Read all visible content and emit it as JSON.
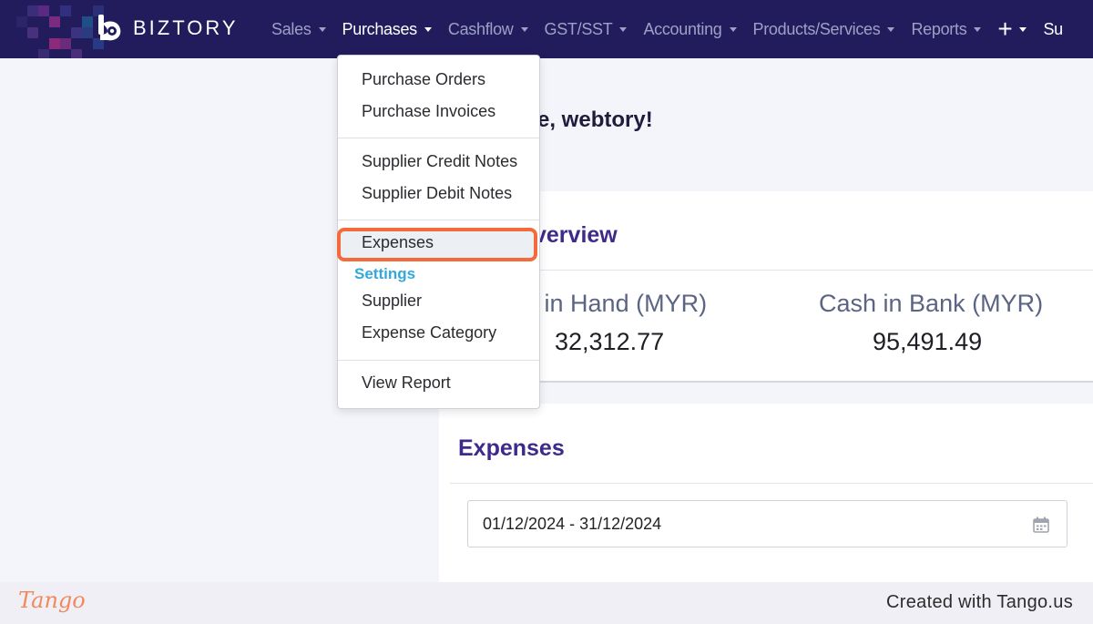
{
  "brand": {
    "name": "BIZTORY",
    "nav_bg": "#221c5c",
    "accent": "#3e2a8c"
  },
  "nav": {
    "items": [
      {
        "label": "Sales",
        "active": false
      },
      {
        "label": "Purchases",
        "active": true
      },
      {
        "label": "Cashflow",
        "active": false
      },
      {
        "label": "GST/SST",
        "active": false
      },
      {
        "label": "Accounting",
        "active": false
      },
      {
        "label": "Products/Services",
        "active": false
      },
      {
        "label": "Reports",
        "active": false
      }
    ],
    "plus_label": "+",
    "overflow_label": "Su"
  },
  "dropdown": {
    "items": [
      "Purchase Orders",
      "Purchase Invoices",
      "Supplier Credit Notes",
      "Supplier Debit Notes",
      "Expenses",
      "Supplier",
      "Expense Category",
      "View Report"
    ],
    "settings_header": "Settings",
    "highlighted_item": "Expenses",
    "highlight_color": "#f36b3d"
  },
  "main": {
    "welcome": "e, webtory!",
    "overview_title": "verview",
    "cash_in_hand_label": "h in Hand (MYR)",
    "cash_in_hand_value": "32,312.77",
    "cash_in_bank_label": "Cash in Bank (MYR)",
    "cash_in_bank_value": "95,491.49",
    "expenses_title": "Expenses",
    "date_range": "01/12/2024 - 31/12/2024"
  },
  "footer": {
    "logo_text": "Tango",
    "credit": "Created with Tango.us"
  },
  "icons": {
    "logo": "biztory-logo-icon",
    "calendar": "calendar-icon",
    "plus": "plus-icon"
  }
}
